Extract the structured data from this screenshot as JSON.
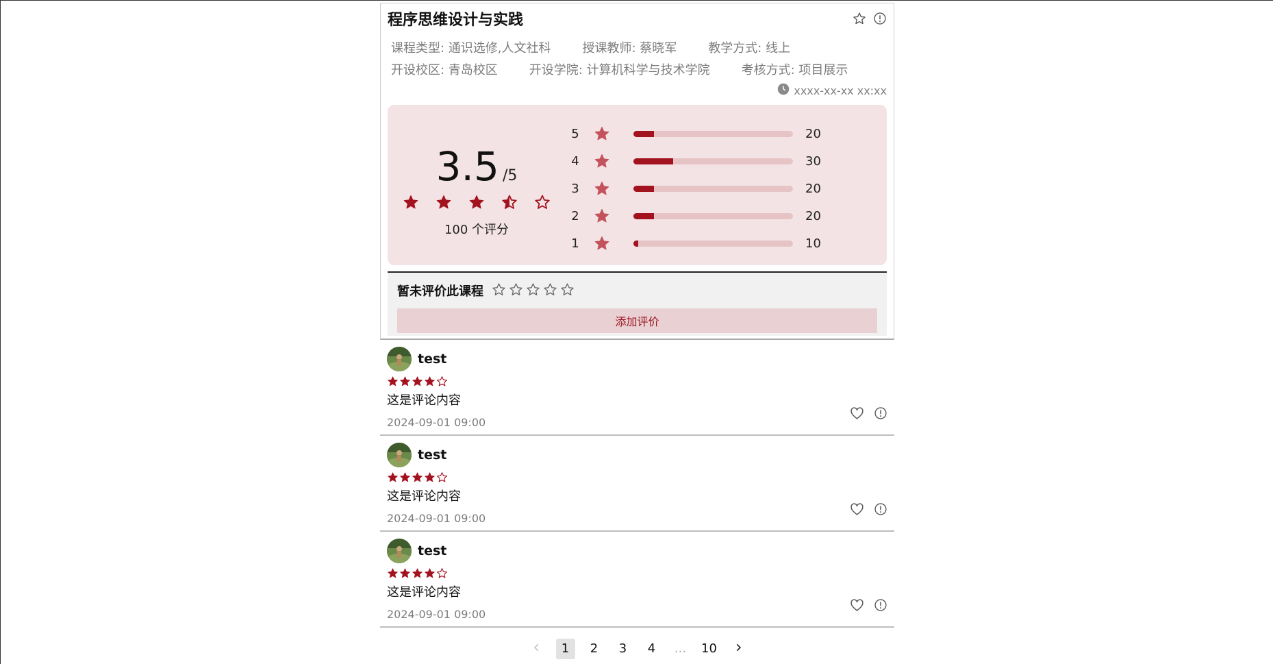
{
  "course": {
    "title": "程序思维设计与实践",
    "meta_row1": [
      "课程类型: 通识选修,人文社科",
      "授课教师: 蔡晓军",
      "教学方式: 线上"
    ],
    "meta_row2": [
      "开设校区: 青岛校区",
      "开设学院: 计算机科学与技术学院",
      "考核方式: 项目展示"
    ],
    "updated_time": "xxxx-xx-xx xx:xx",
    "favorite_icon": "star-outline-icon",
    "report_icon": "alert-circle-icon"
  },
  "rating": {
    "score": "3.5",
    "out_of": "/5",
    "score_value": 3.5,
    "count_label": "100 个评分",
    "distribution": [
      {
        "stars": "5",
        "count": "20",
        "fraction": 0.13
      },
      {
        "stars": "4",
        "count": "30",
        "fraction": 0.25
      },
      {
        "stars": "3",
        "count": "20",
        "fraction": 0.13
      },
      {
        "stars": "2",
        "count": "20",
        "fraction": 0.13
      },
      {
        "stars": "1",
        "count": "10",
        "fraction": 0.03
      }
    ]
  },
  "my_review": {
    "label": "暂未评价此课程",
    "button_label": "添加评价",
    "rating": 0
  },
  "comments": [
    {
      "name": "test",
      "rating": 4,
      "text": "这是评论内容",
      "time": "2024-09-01 09:00"
    },
    {
      "name": "test",
      "rating": 4,
      "text": "这是评论内容",
      "time": "2024-09-01 09:00"
    },
    {
      "name": "test",
      "rating": 4,
      "text": "这是评论内容",
      "time": "2024-09-01 09:00"
    }
  ],
  "pagination": {
    "pages": [
      "1",
      "2",
      "3",
      "4",
      "...",
      "10"
    ],
    "current": "1"
  },
  "colors": {
    "accent": "#a3121f",
    "panel_bg": "#f4e3e4",
    "bar_track": "#e6c4c6",
    "muted_text": "#7c7c7c"
  }
}
